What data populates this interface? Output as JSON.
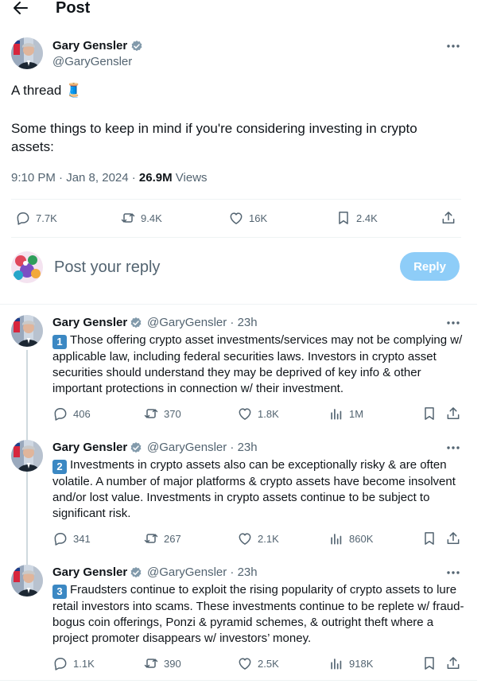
{
  "header": {
    "title": "Post"
  },
  "post": {
    "author_name": "Gary Gensler",
    "handle": "@GaryGensler",
    "text_line1": "A thread 🧵",
    "text_line2": "Some things to keep in mind if you're considering investing in crypto",
    "text_line3": "assets:",
    "time": "9:10 PM · Jan 8, 2024 · ",
    "views_count": "26.9M",
    "views_label": " Views",
    "stats": {
      "replies": "7.7K",
      "reposts": "9.4K",
      "likes": "16K",
      "bookmarks": "2.4K"
    }
  },
  "reply_box": {
    "placeholder": "Post your reply",
    "button_label": "Reply"
  },
  "replies": [
    {
      "author_name": "Gary Gensler",
      "handle_time": "@GaryGensler · 23h",
      "badge": "1",
      "text": "Those offering crypto asset investments/services may not be complying w/ applicable law, including federal securities laws. Investors in crypto asset securities should understand they may be deprived of key info & other important protections in connection w/ their investment.",
      "stats": {
        "replies": "406",
        "reposts": "370",
        "likes": "1.8K",
        "views": "1M"
      }
    },
    {
      "author_name": "Gary Gensler",
      "handle_time": "@GaryGensler · 23h",
      "badge": "2",
      "text": "Investments in crypto assets also can be exceptionally risky & are often volatile. A number of major platforms & crypto assets have become insolvent and/or lost value. Investments in crypto assets continue to be subject to significant risk.",
      "stats": {
        "replies": "341",
        "reposts": "267",
        "likes": "2.1K",
        "views": "860K"
      }
    },
    {
      "author_name": "Gary Gensler",
      "handle_time": "@GaryGensler · 23h",
      "badge": "3",
      "text": "Fraudsters continue to exploit the rising popularity of crypto assets to lure retail investors into scams. These investments continue to be replete w/ fraud- bogus coin offerings, Ponzi & pyramid schemes, & outright theft where a project promoter disappears w/ investors’ money.",
      "stats": {
        "replies": "1.1K",
        "reposts": "390",
        "likes": "2.5K",
        "views": "918K"
      }
    }
  ]
}
